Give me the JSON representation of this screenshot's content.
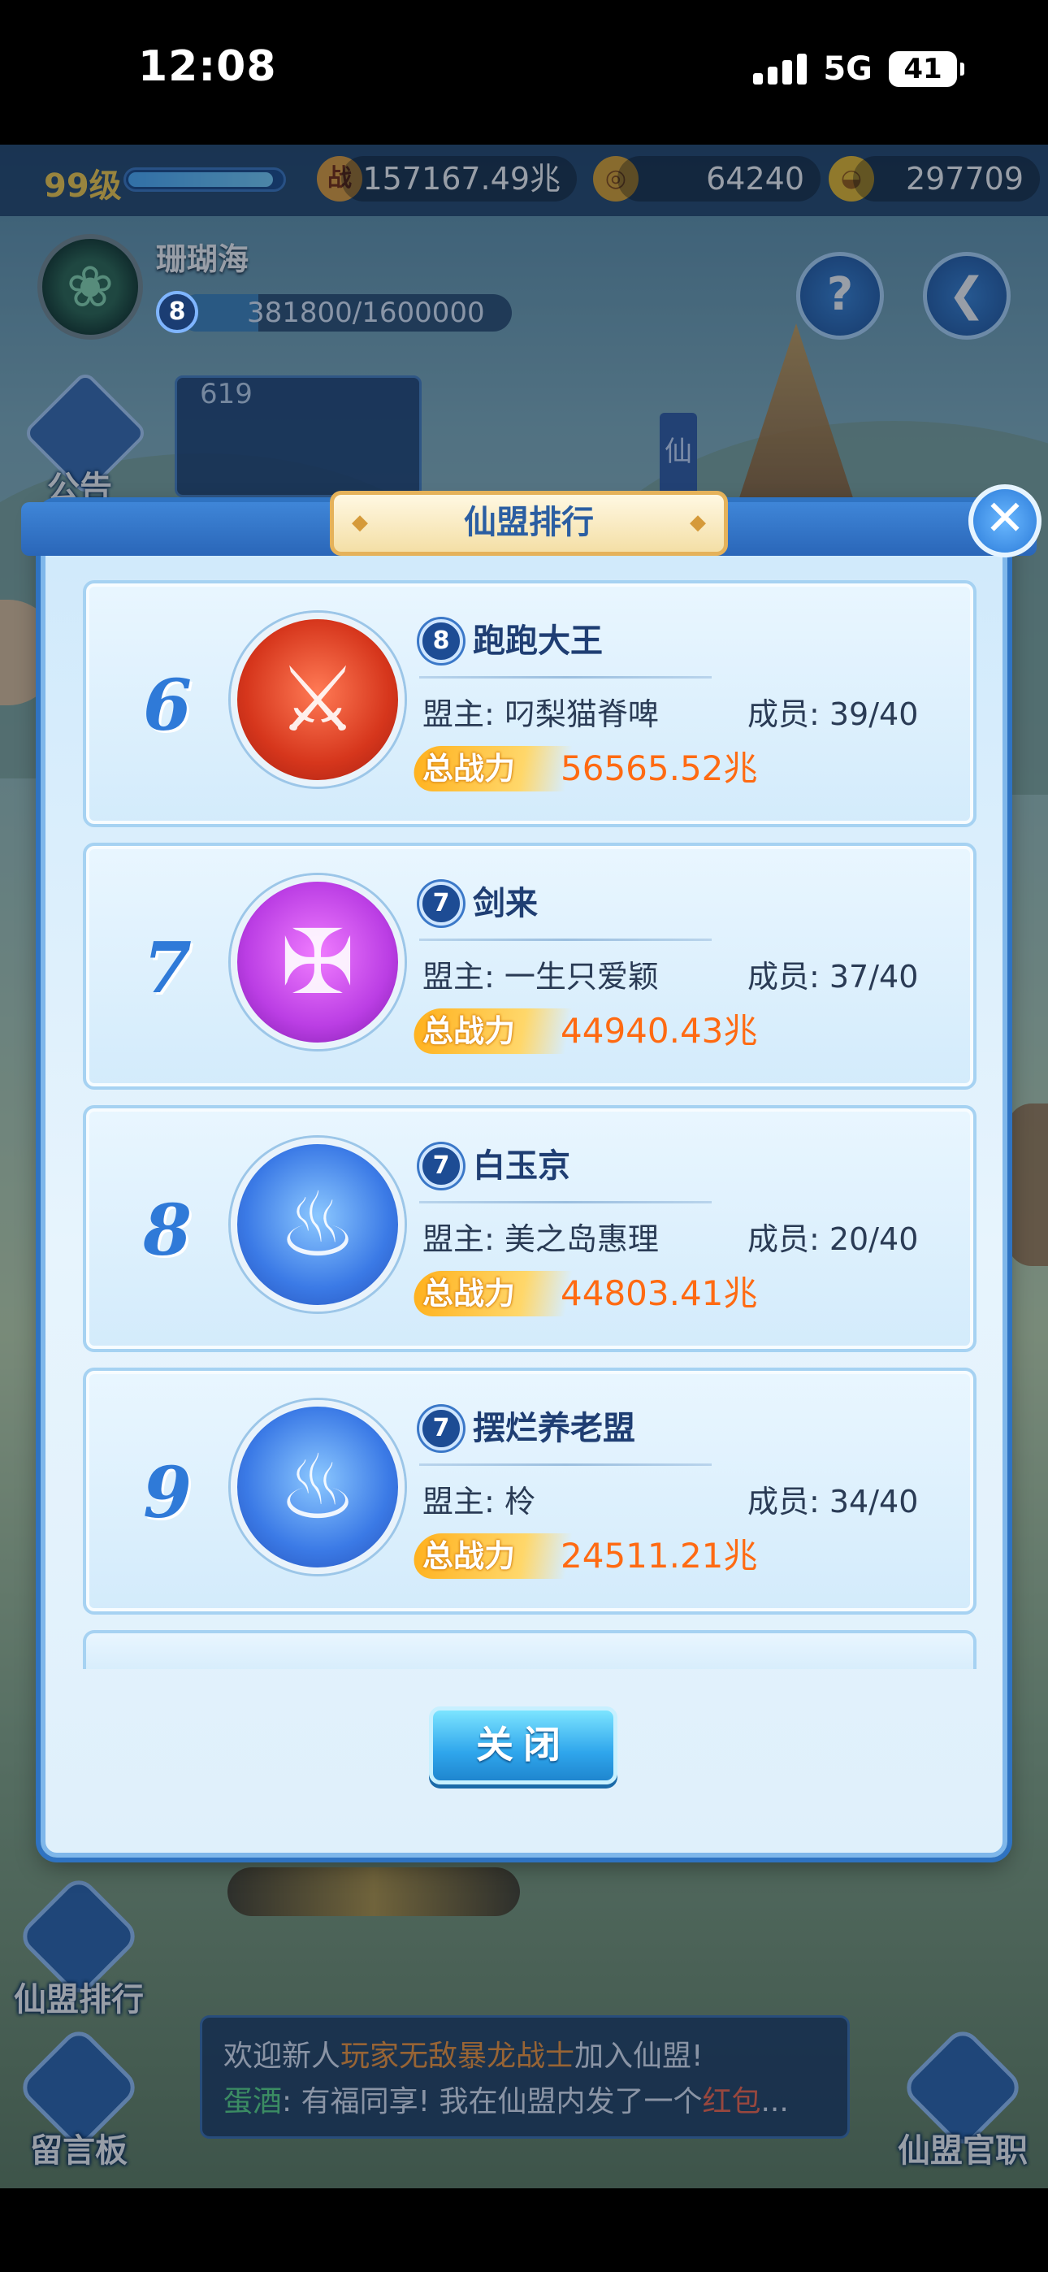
{
  "status_bar": {
    "time": "12:08",
    "network": "5G",
    "battery": "41"
  },
  "topbar": {
    "level": "99级",
    "power_icon": "战",
    "power": "157167.49兆",
    "copper": "64240",
    "gold": "297709"
  },
  "alliance": {
    "name": "珊瑚海",
    "level": "8",
    "exp": "381800/1600000",
    "exp_fraction": 0.239
  },
  "notice": {
    "label": "公告",
    "text": "619"
  },
  "scene_flag": "仙",
  "modal": {
    "title": "仙盟排行",
    "close_label": "关闭",
    "entries": [
      {
        "rank": "6",
        "level": "8",
        "name": "跑跑大王",
        "leader": "盟主: 叼梨猫脊啤",
        "members": "成员: 39/40",
        "power_label": "总战力",
        "power": "56565.52兆",
        "crest": "red",
        "crest_icon": "swords-crest-icon"
      },
      {
        "rank": "7",
        "level": "7",
        "name": "剑来",
        "leader": "盟主: 一生只爱颖",
        "members": "成员: 37/40",
        "power_label": "总战力",
        "power": "44940.43兆",
        "crest": "purple",
        "crest_icon": "sword-crest-icon"
      },
      {
        "rank": "8",
        "level": "7",
        "name": "白玉京",
        "leader": "盟主: 美之岛惠理",
        "members": "成员: 20/40",
        "power_label": "总战力",
        "power": "44803.41兆",
        "crest": "blue",
        "crest_icon": "cloud-crest-icon"
      },
      {
        "rank": "9",
        "level": "7",
        "name": "摆烂养老盟",
        "leader": "盟主: 柃",
        "members": "成员: 34/40",
        "power_label": "总战力",
        "power": "24511.21兆",
        "crest": "blue",
        "crest_icon": "cloud-crest-icon"
      }
    ]
  },
  "side_buttons": {
    "ranking": "仙盟排行",
    "message_board": "留言板",
    "official": "仙盟官职"
  },
  "chat": {
    "line1_prefix": "欢迎新人",
    "line1_player": "玩家无敌暴龙战士",
    "line1_suffix": "加入仙盟!",
    "line2_speaker": "蛋酒",
    "line2_text": ": 有福同享! 我在仙盟内发了一个",
    "line2_highlight": "红包",
    "line2_ellipsis": "..."
  },
  "colors": {
    "accent_blue": "#2f7ad8",
    "power_orange": "#ff6a12",
    "title_navy": "#1f3e73"
  }
}
